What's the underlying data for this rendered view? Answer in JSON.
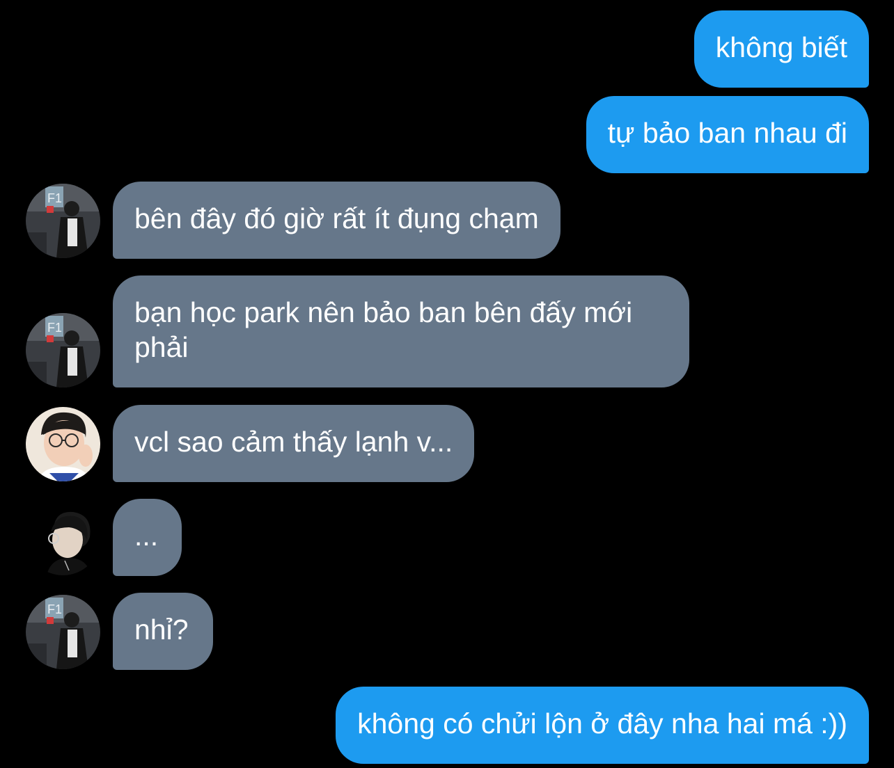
{
  "conversation": {
    "messages": [
      {
        "direction": "outgoing",
        "text": "không biết"
      },
      {
        "direction": "outgoing",
        "text": "tự bảo ban nhau đi"
      },
      {
        "direction": "incoming",
        "sender_avatar": "f1-boy-avatar",
        "text": "bên đây đó giờ rất ít đụng chạm"
      },
      {
        "direction": "incoming",
        "sender_avatar": "f1-boy-avatar",
        "text": "bạn học park nên bảo ban bên đấy mới phải"
      },
      {
        "direction": "incoming",
        "sender_avatar": "glasses-boy-avatar",
        "text": "vcl sao cảm thấy lạnh v..."
      },
      {
        "direction": "incoming",
        "sender_avatar": "profile-boy-avatar",
        "text": "..."
      },
      {
        "direction": "incoming",
        "sender_avatar": "f1-boy-avatar",
        "text": "nhỉ?"
      },
      {
        "direction": "outgoing",
        "text": "không có chửi lộn ở đây nha hai má :))"
      }
    ],
    "avatar_badge_text": "F1"
  },
  "colors": {
    "background": "#000000",
    "outgoing_bubble": "#1d9bf0",
    "incoming_bubble": "#66778a",
    "text": "#ffffff"
  }
}
